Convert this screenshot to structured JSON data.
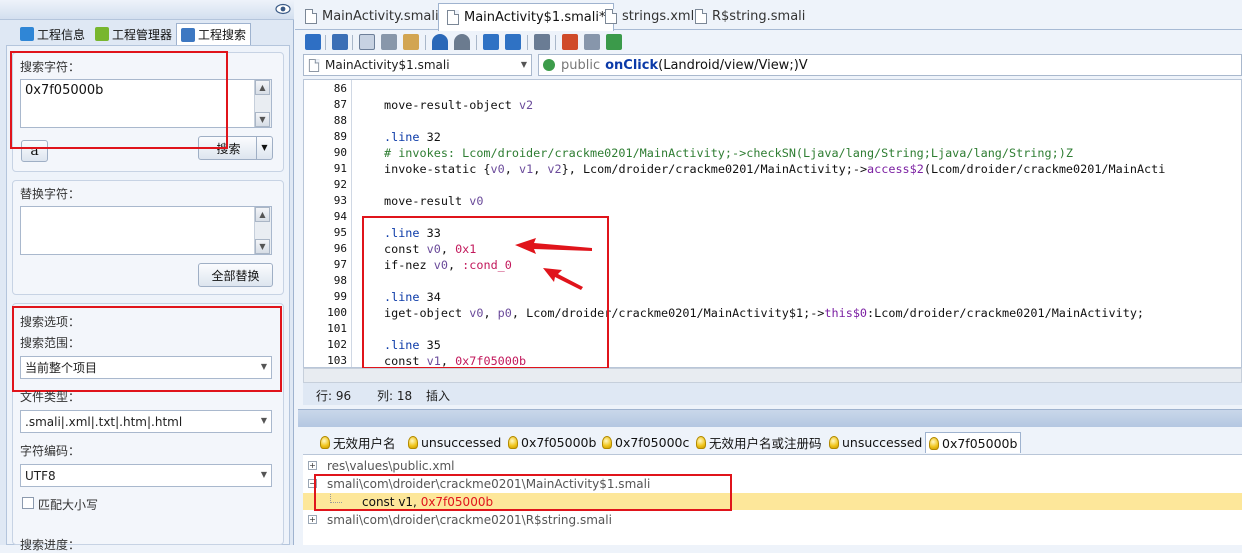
{
  "left_panel": {
    "tabs": [
      {
        "label": "工程信息",
        "active": false
      },
      {
        "label": "工程管理器",
        "active": false
      },
      {
        "label": "工程搜索",
        "active": true
      }
    ],
    "search": {
      "label": "搜索字符：",
      "value": "0x7f05000b",
      "case_button": "a",
      "search_button": "搜索"
    },
    "replace": {
      "label": "替换字符：",
      "value": "",
      "replace_all_button": "全部替换"
    },
    "options": {
      "label": "搜索选项：",
      "scope_label": "搜索范围：",
      "scope_value": "当前整个项目",
      "filetype_label": "文件类型：",
      "filetype_value": ".smali|.xml|.txt|.htm|.html",
      "encoding_label": "字符编码：",
      "encoding_value": "UTF8",
      "match_case_label": "匹配大小写",
      "match_case_checked": false,
      "progress_label": "搜索进度："
    }
  },
  "doc_tabs": [
    {
      "label": "MainActivity.smali",
      "active": false
    },
    {
      "label": "MainActivity$1.smali*",
      "active": true
    },
    {
      "label": "strings.xml",
      "active": false
    },
    {
      "label": "R$string.smali",
      "active": false
    }
  ],
  "nav": {
    "file_combo": "MainActivity$1.smali",
    "method_prefix": "public",
    "method_name": "onClick",
    "method_sig": "(Landroid/view/View;)V"
  },
  "code": {
    "lines": [
      {
        "n": "86",
        "t": ""
      },
      {
        "n": "87",
        "t": "move-result-object v2"
      },
      {
        "n": "88",
        "t": ""
      },
      {
        "n": "89",
        "t": ".line 32"
      },
      {
        "n": "90",
        "t": "# invokes: Lcom/droider/crackme0201/MainActivity;->checkSN(Ljava/lang/String;Ljava/lang/String;)Z"
      },
      {
        "n": "91",
        "t": "invoke-static {v0, v1, v2}, Lcom/droider/crackme0201/MainActivity;->access$2(Lcom/droider/crackme0201/MainActi"
      },
      {
        "n": "92",
        "t": ""
      },
      {
        "n": "93",
        "t": "move-result v0"
      },
      {
        "n": "94",
        "t": ""
      },
      {
        "n": "95",
        "t": ".line 33"
      },
      {
        "n": "96",
        "t": "const v0, 0x1"
      },
      {
        "n": "97",
        "t": "if-nez v0, :cond_0"
      },
      {
        "n": "98",
        "t": ""
      },
      {
        "n": "99",
        "t": ".line 34"
      },
      {
        "n": "100",
        "t": "iget-object v0, p0, Lcom/droider/crackme0201/MainActivity$1;->this$0:Lcom/droider/crackme0201/MainActivity;"
      },
      {
        "n": "101",
        "t": ""
      },
      {
        "n": "102",
        "t": ".line 35"
      },
      {
        "n": "103",
        "t": "const v1, 0x7f05000b"
      }
    ]
  },
  "status": {
    "row_label": "行: 96",
    "col_label": "列: 18",
    "mode": "插入"
  },
  "result_tabs": [
    {
      "label": "无效用户名",
      "active": false
    },
    {
      "label": "unsuccessed",
      "active": false
    },
    {
      "label": "0x7f05000b",
      "active": false
    },
    {
      "label": "0x7f05000c",
      "active": false
    },
    {
      "label": "无效用户名或注册码",
      "active": false
    },
    {
      "label": "unsuccessed",
      "active": false
    },
    {
      "label": "0x7f05000b",
      "active": true
    }
  ],
  "results": [
    {
      "kind": "file",
      "text": "res\\values\\public.xml",
      "expanded": false
    },
    {
      "kind": "file",
      "text": "smali\\com\\droider\\crackme0201\\MainActivity$1.smali",
      "expanded": true
    },
    {
      "kind": "match",
      "prefix": "const v1, ",
      "hit": "0x7f05000b"
    },
    {
      "kind": "file",
      "text": "smali\\com\\droider\\crackme0201\\R$string.smali",
      "expanded": false
    }
  ]
}
